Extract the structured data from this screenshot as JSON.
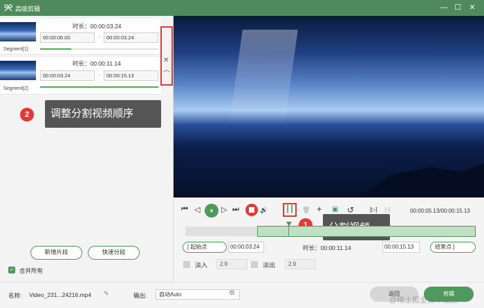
{
  "window": {
    "title": "高级剪辑",
    "minimize": "—",
    "maximize": "☐",
    "close": "✕"
  },
  "segments": [
    {
      "label": "Segment[1]",
      "duration": "时长：00:00:03.24",
      "start": "00:00:00.00",
      "end": "00:00:03.24",
      "dash": "-"
    },
    {
      "label": "Segment[2]",
      "duration": "时长：00:00:11.14",
      "start": "00:00:03.24",
      "end": "00:00:15.13",
      "dash": "-"
    }
  ],
  "reorder": {
    "close_glyph": "✕",
    "up_glyph": "︿"
  },
  "callouts": {
    "reorder": {
      "number": "2",
      "text": "调整分割视频顺序"
    },
    "split": {
      "number": "1",
      "text": "分割视频"
    }
  },
  "left_buttons": {
    "add_segment": "新增片段",
    "fast_split": "快速分段"
  },
  "merge_all": {
    "label": "合并所有",
    "check": "✓",
    "checked": true
  },
  "player": {
    "time_readout": "00:00:05.13/00:00:15.13",
    "controls": {
      "start": "⏮",
      "prev": "◁",
      "play": "⏸",
      "next": "▷",
      "end": "⏭",
      "volume": "🔊",
      "delete": "🗑",
      "add": "+",
      "copy": "▣",
      "undo": "↺",
      "crop1": "[▷]",
      "crop2": "[▫]",
      "split": "┃┃"
    }
  },
  "timeline": {
    "playhead_fraction": 0.35,
    "selection_start_fraction": 0.248,
    "selection_end_fraction": 1.0
  },
  "trim": {
    "start_btn": "[  起始点",
    "start_value": "00:00:03.24",
    "duration": "时长：00:00:11.14",
    "end_value": "00:00:15.13",
    "end_btn": "结束点  ]"
  },
  "fade": {
    "in_label": "淡入",
    "in_value": "2.9",
    "out_label": "淡出",
    "out_value": "2.9"
  },
  "bottom": {
    "name_label": "名称:",
    "name_value": "Video_231...24216.mp4",
    "edit_glyph": "✎",
    "output_label": "输出:",
    "output_value": "自动Auto",
    "gear_glyph": "⚙",
    "back": "返回",
    "cut": "剪辑",
    "watermark": "@稀土掘金技术社区"
  },
  "colors": {
    "accent": "#4e9a5c",
    "title_bar": "#4e8a5c",
    "highlight": "#e53935"
  }
}
